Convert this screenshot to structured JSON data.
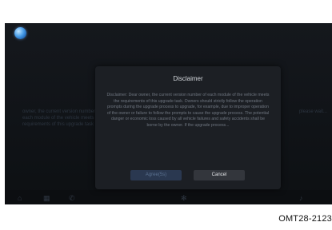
{
  "dialog": {
    "title": "Disclaimer",
    "body": "Disclaimer: Dear owner, the current version number of each module of the vehicle meets the requirements of this upgrade task. Owners should strictly follow the operation prompts during the upgrade process to upgrade, for example, due to improper operation of the owner or failure to follow the prompts to cause the upgrade process. The potential danger or economic loss caused by all vehicle failures and safety accidents shall be borne by the owner. If the upgrade process...",
    "agree_label": "Agree(5s)",
    "cancel_label": "Cancel"
  },
  "background": {
    "left_text": "owner, the current version number of each module of the vehicle meets the requirements of this upgrade task",
    "right_text": "please wait..."
  },
  "dock": {
    "icons": [
      "home-icon",
      "grid-icon",
      "phone-icon",
      "fan-icon",
      "music-icon"
    ]
  },
  "figure_code": "OMT28-2123"
}
